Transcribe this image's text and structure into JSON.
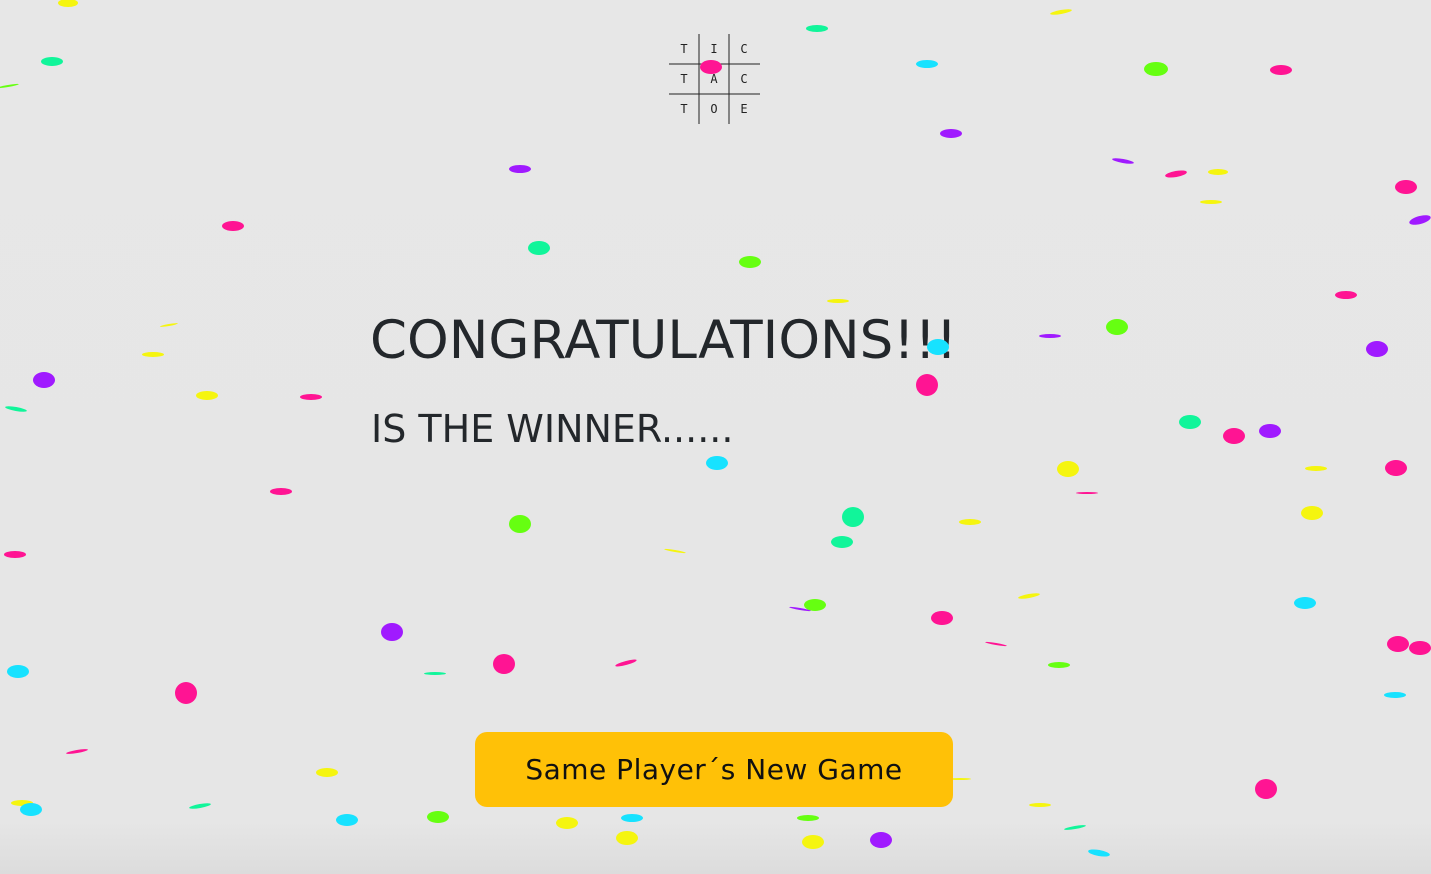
{
  "logo": {
    "letters": [
      "T",
      "I",
      "C",
      "T",
      "A",
      "C",
      "T",
      "O",
      "E"
    ]
  },
  "headline": "CONGRATULATIONS!!!",
  "winner_text": "IS THE WINNER......",
  "new_game_button": "Same Player´s New Game",
  "colors": {
    "background": "#e6e6e6",
    "text": "#23272b",
    "button": "#ffc107",
    "confetti": [
      "#ff1493",
      "#a01aff",
      "#11f59a",
      "#17e2ff",
      "#66ff11",
      "#f5f50f"
    ]
  }
}
